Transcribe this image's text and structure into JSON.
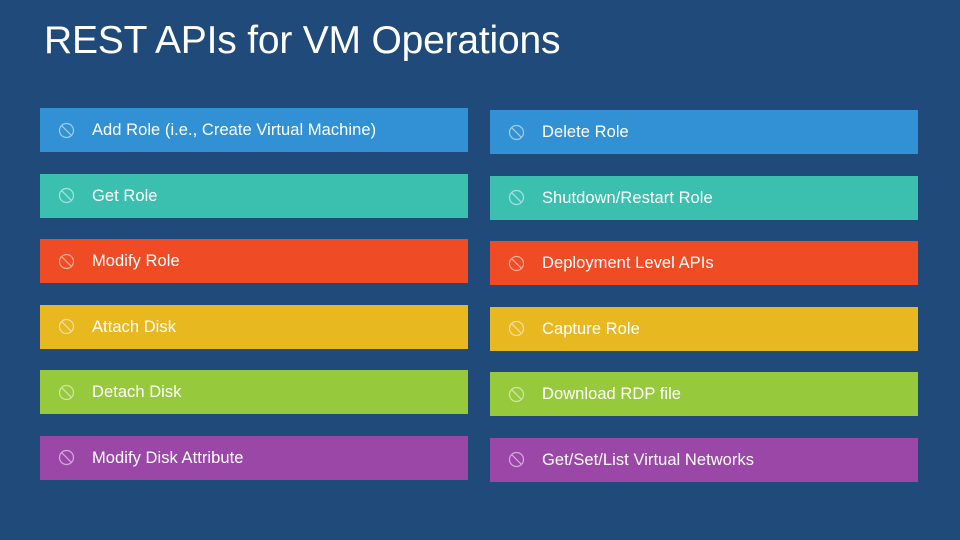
{
  "slide": {
    "title": "REST APIs for VM Operations",
    "background_color": "#1F4A79",
    "title_color": "#FFFFFF"
  },
  "icon": {
    "name": "prohibited-circle-slash-icon",
    "color": "#FFFFFF"
  },
  "palette": {
    "blue": "#3191D4",
    "teal": "#3BC0B0",
    "orange": "#EF4B25",
    "gold": "#E8B820",
    "green": "#97C93D",
    "purple": "#9B47A8"
  },
  "columns": {
    "left": {
      "items": [
        {
          "label": "Add Role (i.e., Create Virtual Machine)",
          "color": "#3191D4"
        },
        {
          "label": "Get Role",
          "color": "#3BC0B0"
        },
        {
          "label": "Modify Role",
          "color": "#EF4B25"
        },
        {
          "label": "Attach Disk",
          "color": "#E8B820"
        },
        {
          "label": "Detach Disk",
          "color": "#97C93D"
        },
        {
          "label": "Modify Disk Attribute",
          "color": "#9B47A8"
        }
      ]
    },
    "right": {
      "items": [
        {
          "label": "Delete Role",
          "color": "#3191D4"
        },
        {
          "label": "Shutdown/Restart Role",
          "color": "#3BC0B0"
        },
        {
          "label": "Deployment Level APIs",
          "color": "#EF4B25"
        },
        {
          "label": "Capture Role",
          "color": "#E8B820"
        },
        {
          "label": "Download RDP file",
          "color": "#97C93D"
        },
        {
          "label": "Get/Set/List Virtual Networks",
          "color": "#9B47A8"
        }
      ]
    }
  },
  "layout": {
    "row_top_start": 108,
    "row_pitch": 65.5
  }
}
